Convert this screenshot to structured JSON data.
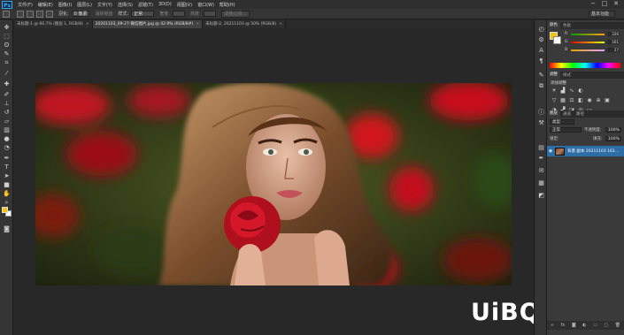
{
  "app": {
    "logo": "Ps",
    "menu": [
      "文件(F)",
      "编辑(E)",
      "图像(I)",
      "图层(L)",
      "文字(Y)",
      "选择(S)",
      "滤镜(T)",
      "3D(D)",
      "视图(V)",
      "窗口(W)",
      "帮助(H)"
    ],
    "window_controls": [
      "−",
      "□",
      "✕"
    ]
  },
  "options_bar": {
    "feather_label": "羽化:",
    "feather_value": "0 像素",
    "antialias_label": "消除锯齿",
    "style_label": "样式:",
    "style_value": "正常",
    "width_label": "宽度:",
    "height_label": "高度:",
    "refine_button": "调整边缘...",
    "workspace": "基本功能"
  },
  "tabs": [
    {
      "label": "未标题-1 @ 66.7% (图层 1, RGB/8)",
      "active": false
    },
    {
      "label": "20201103_09-27-微信图片.jpg @ 42.9% (RGB/8#)",
      "active": true
    },
    {
      "label": "未标题-2, 20211103 @ 50% (RGB/8)",
      "active": false
    }
  ],
  "tools": [
    "move-tool-icon",
    "marquee-tool-icon",
    "lasso-tool-icon",
    "quick-select-icon",
    "crop-tool-icon",
    "eyedropper-icon",
    "healing-brush-icon",
    "brush-tool-icon",
    "clone-stamp-icon",
    "history-brush-icon",
    "eraser-icon",
    "gradient-tool-icon",
    "blur-tool-icon",
    "dodge-tool-icon",
    "pen-tool-icon",
    "type-tool-icon",
    "path-select-icon",
    "shape-tool-icon",
    "hand-tool-icon",
    "zoom-tool-icon"
  ],
  "color_panel": {
    "tabs": [
      "颜色",
      "色板"
    ],
    "sliders": [
      {
        "label": "R",
        "value": "226",
        "gradient": "linear-gradient(to right,#00c800,#ffc800)"
      },
      {
        "label": "G",
        "value": "161",
        "gradient": "linear-gradient(to right,#e20000,#e2ff00)"
      },
      {
        "label": "B",
        "value": "27",
        "gradient": "linear-gradient(to right,#e2a100,#e2a1ff)"
      }
    ]
  },
  "adjustments_panel": {
    "tabs": [
      "调整",
      "样式"
    ],
    "title": "添加调整"
  },
  "layers_panel": {
    "tabs": [
      "图层",
      "通道",
      "路径"
    ],
    "kind": "类型",
    "blend_mode": "正常",
    "opacity_label": "不透明度:",
    "opacity_value": "100%",
    "lock_label": "锁定:",
    "fill_label": "填充:",
    "fill_value": "100%",
    "layer_name": "背景 副本  20211103 161..."
  },
  "watermark": "UiBQ.CoM",
  "colors": {
    "foreground": "#f1c40f",
    "background": "#ffffff",
    "selected_layer": "#2d6da8"
  }
}
